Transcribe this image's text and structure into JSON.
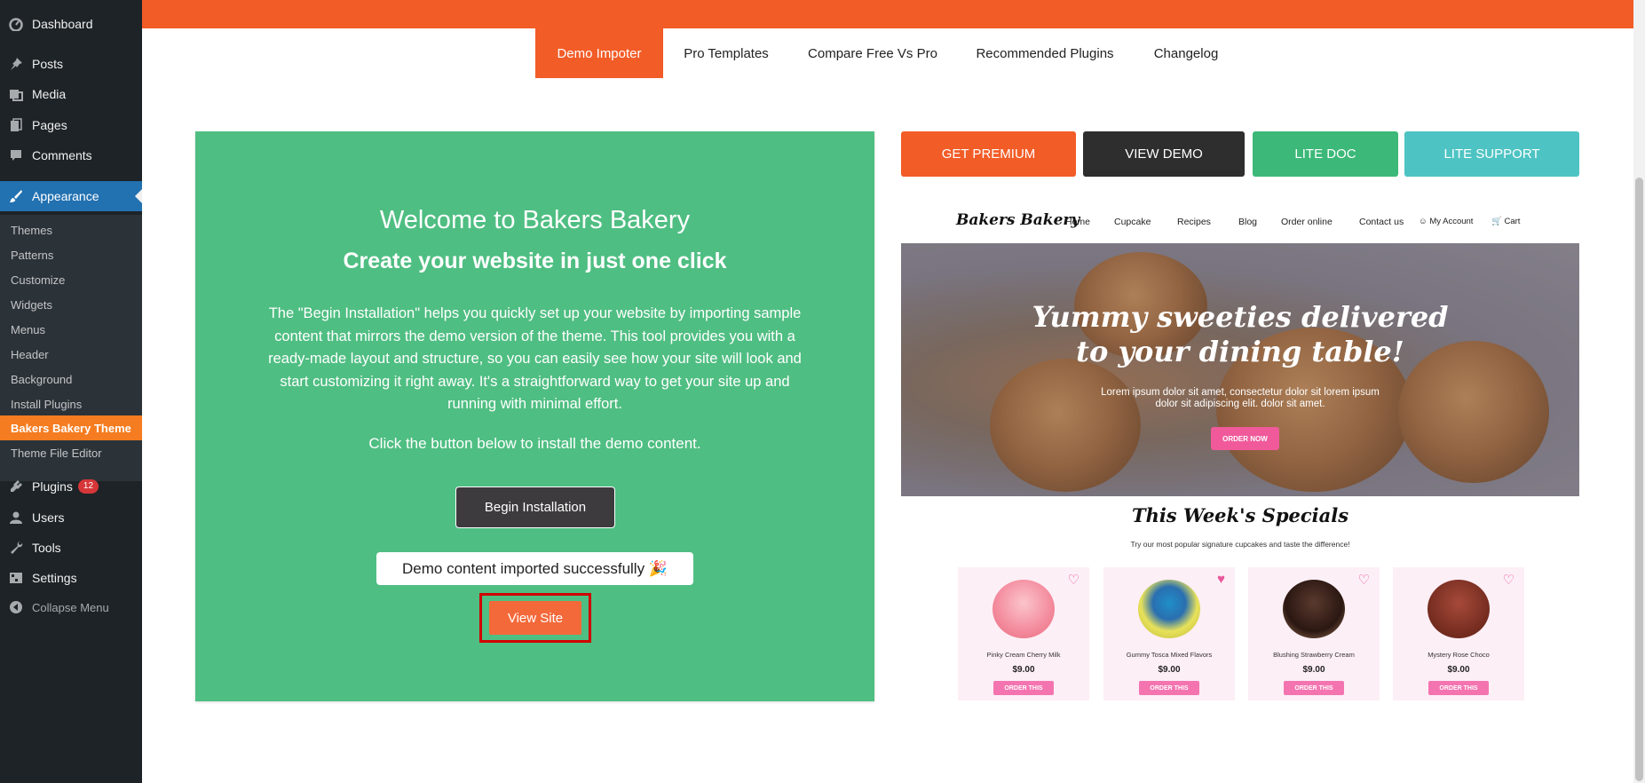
{
  "sidebar": {
    "items": [
      {
        "label": "Dashboard",
        "icon": "dashboard-icon"
      },
      {
        "label": "Posts",
        "icon": "pin-icon"
      },
      {
        "label": "Media",
        "icon": "media-icon"
      },
      {
        "label": "Pages",
        "icon": "pages-icon"
      },
      {
        "label": "Comments",
        "icon": "comment-icon"
      },
      {
        "label": "Appearance",
        "icon": "brush-icon"
      }
    ],
    "submenu": [
      "Themes",
      "Patterns",
      "Customize",
      "Widgets",
      "Menus",
      "Header",
      "Background",
      "Install Plugins",
      "Bakers Bakery Theme",
      "Theme File Editor"
    ],
    "lower_items": [
      {
        "label": "Plugins",
        "icon": "plugin-icon",
        "badge": "12"
      },
      {
        "label": "Users",
        "icon": "user-icon"
      },
      {
        "label": "Tools",
        "icon": "wrench-icon"
      },
      {
        "label": "Settings",
        "icon": "settings-icon"
      }
    ],
    "collapse_label": "Collapse Menu"
  },
  "tabs": [
    "Demo Impoter",
    "Pro Templates",
    "Compare Free Vs Pro",
    "Recommended Plugins",
    "Changelog"
  ],
  "panel": {
    "title": "Welcome to Bakers Bakery",
    "subtitle": "Create your website in just one click",
    "description": "The \"Begin Installation\" helps you quickly set up your website by importing sample content that mirrors the demo version of the theme. This tool provides you with a ready-made layout and structure, so you can easily see how your site will look and start customizing it right away. It's a straightforward way to get your site up and running with minimal effort.",
    "hint": "Click the button below to install the demo content.",
    "begin_button": "Begin Installation",
    "success_message": "Demo content imported successfully 🎉",
    "view_button": "View Site"
  },
  "actions": [
    "GET PREMIUM",
    "VIEW DEMO",
    "LITE DOC",
    "LITE SUPPORT"
  ],
  "colors": {
    "brand_orange": "#f25c27",
    "panel_green": "#4fbe82",
    "dark": "#2e2e2e",
    "lite_doc": "#3cb878",
    "lite_support": "#4ec3c3",
    "sidebar_bg": "#1d2327",
    "sidebar_active": "#2271b1",
    "highlight_red": "#d00000",
    "pink": "#f474b0"
  },
  "preview": {
    "logo": "Bakers Bakery",
    "nav": [
      "Home",
      "Cupcake",
      "Recipes",
      "Blog",
      "Order online",
      "Contact us",
      "My Account",
      "Cart"
    ],
    "hero_title_1": "Yummy sweeties delivered",
    "hero_title_2": "to your dining table!",
    "hero_text": "Lorem ipsum dolor sit amet, consectetur dolor sit lorem ipsum dolor sit adipiscing elit. dolor sit amet.",
    "hero_button": "ORDER NOW",
    "specials_title": "This Week's Specials",
    "specials_sub": "Try our most popular signature cupcakes and taste the difference!",
    "products": [
      {
        "name": "Pinky Cream Cherry Milk",
        "price": "$9.00",
        "button": "ORDER THIS",
        "liked": false
      },
      {
        "name": "Gummy Tosca Mixed Flavors",
        "price": "$9.00",
        "button": "ORDER THIS",
        "liked": true
      },
      {
        "name": "Blushing Strawberry Cream",
        "price": "$9.00",
        "button": "ORDER THIS",
        "liked": false
      },
      {
        "name": "Mystery Rose Choco",
        "price": "$9.00",
        "button": "ORDER THIS",
        "liked": false
      }
    ]
  }
}
